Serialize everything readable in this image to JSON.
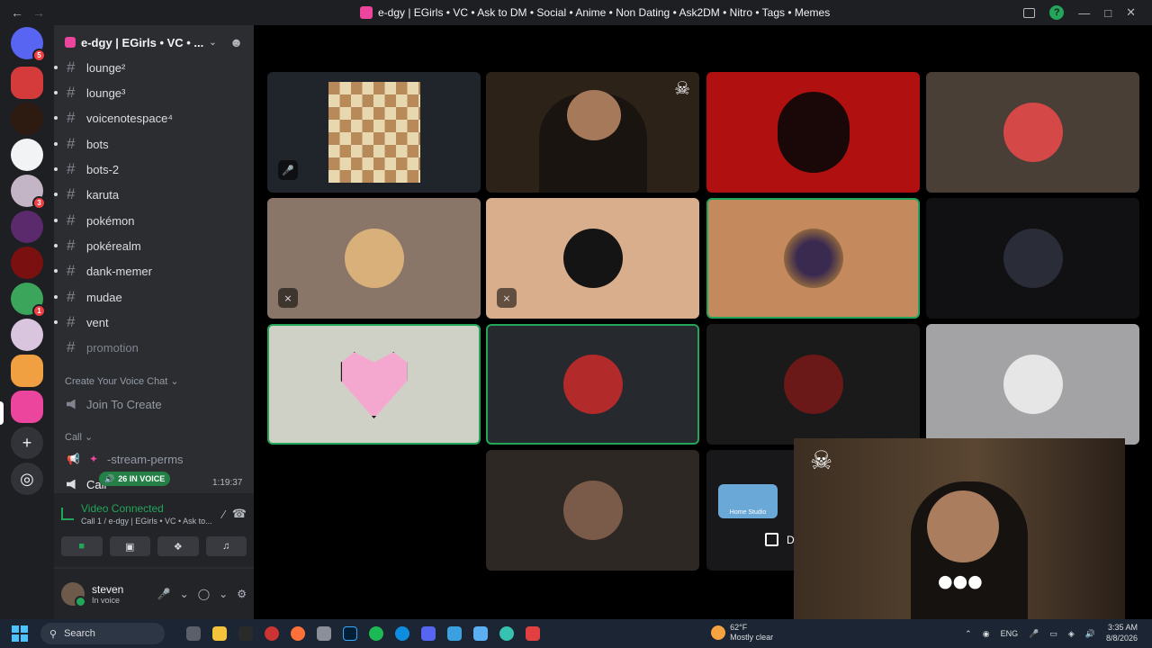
{
  "window": {
    "title": "e-dgy | EGirls • VC • Ask to DM • Social • Anime • Non Dating • Ask2DM • Nitro • Tags • Memes",
    "back_icon": "arrow-left-icon",
    "forward_icon": "arrow-right-icon"
  },
  "servers": {
    "home_badge": "5",
    "badges": [
      "3",
      "1"
    ]
  },
  "guild": {
    "name": "e-dgy | EGirls • VC • ..."
  },
  "channels": [
    {
      "name": "lounge²",
      "unread": true
    },
    {
      "name": "lounge³",
      "unread": true
    },
    {
      "name": "voicenotespace⁴",
      "unread": true
    },
    {
      "name": "bots",
      "unread": true
    },
    {
      "name": "bots-2",
      "unread": true
    },
    {
      "name": "karuta",
      "unread": true
    },
    {
      "name": "pokémon",
      "unread": true
    },
    {
      "name": "pokérealm",
      "unread": true
    },
    {
      "name": "dank-memer",
      "unread": true
    },
    {
      "name": "mudae",
      "unread": true
    },
    {
      "name": "vent",
      "unread": true
    },
    {
      "name": "promotion",
      "unread": false
    }
  ],
  "voice_section": {
    "category_create": "Create Your Voice Chat",
    "join_to_create": "Join To Create",
    "category_call": "Call",
    "stream_perms": "-stream-perms",
    "call_channel": "Call",
    "in_voice_badge": "26 IN VOICE",
    "call_timer": "1:19:37"
  },
  "voice_panel": {
    "status": "Video Connected",
    "subtitle": "Call 1 / e-dgy | EGirls • VC • Ask to..."
  },
  "user": {
    "name": "steven",
    "status": "In voice"
  },
  "popout": {
    "shared_app_label": "Home Studio",
    "checkbox_label": "D"
  },
  "taskbar": {
    "search_placeholder": "Search",
    "weather_temp": "62°F",
    "weather_desc": "Mostly clear",
    "lang": "ENG",
    "time": "3:35 AM",
    "date": "8/8/2026"
  },
  "colors": {
    "accent_green": "#23a55a",
    "brand_pink": "#eb459e",
    "background": "#1e1f22"
  }
}
